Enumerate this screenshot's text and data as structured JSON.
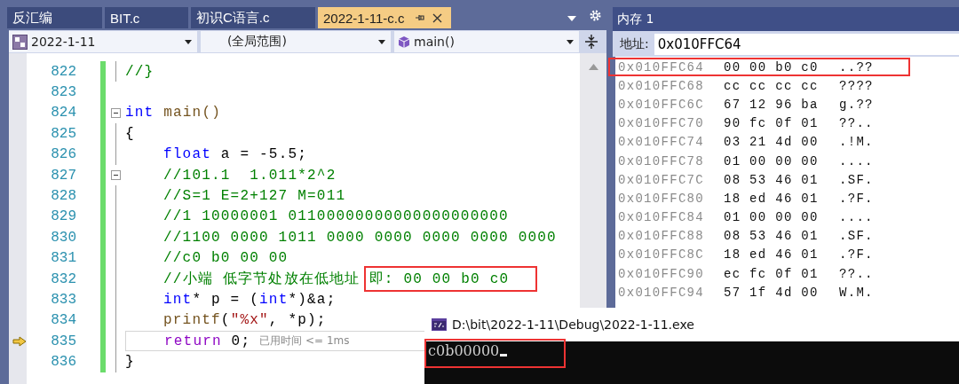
{
  "tabs": [
    {
      "label": "反汇编",
      "selected": false
    },
    {
      "label": "BIT.c",
      "selected": false
    },
    {
      "label": "初识C语言.c",
      "selected": false
    },
    {
      "label": "2022-1-11-c.c",
      "selected": true
    }
  ],
  "navigation": {
    "project": "2022-1-11",
    "scope": "(全局范围)",
    "function": "main()"
  },
  "code_lines": [
    {
      "number": "822",
      "tokens": [
        {
          "kind": "comment",
          "text": "//}"
        }
      ]
    },
    {
      "number": "823"
    },
    {
      "number": "824",
      "collapsible": true,
      "tokens": [
        {
          "kind": "keyword",
          "text": "int"
        },
        {
          "kind": "function",
          "text": " main()"
        }
      ]
    },
    {
      "number": "825",
      "tokens": [
        {
          "kind": "plain",
          "text": "{"
        }
      ],
      "children": [
        {
          "number": "826",
          "tokens": [
            {
              "kind": "keyword",
              "text": "float"
            },
            {
              "kind": "plain",
              "text": " a = -5.5;"
            }
          ]
        },
        {
          "number": "827",
          "collapsible": true,
          "tokens": [
            {
              "kind": "comment",
              "text": "//101.1  1.011*2^2"
            }
          ]
        },
        {
          "number": "828",
          "tokens": [
            {
              "kind": "comment",
              "text": "//S=1 E=2+127 M=011"
            }
          ]
        },
        {
          "number": "829",
          "tokens": [
            {
              "kind": "comment",
              "text": "//1 10000001 01100000000000000000000"
            }
          ]
        },
        {
          "number": "830",
          "tokens": [
            {
              "kind": "comment",
              "text": "//1100 0000 1011 0000 0000 0000 0000 0000"
            }
          ]
        },
        {
          "number": "831",
          "tokens": [
            {
              "kind": "comment",
              "text": "//c0 b0 00 00"
            }
          ]
        },
        {
          "number": "832",
          "tokens": [
            {
              "kind": "comment",
              "text": "//小端 低字节处放在低地址"
            },
            {
              "kind": "comment",
              "text": "即: 00 00 b0 c0",
              "boxed": true
            }
          ]
        },
        {
          "number": "833",
          "tokens": [
            {
              "kind": "keyword",
              "text": "int"
            },
            {
              "kind": "plain",
              "text": "* p = ("
            },
            {
              "kind": "keyword",
              "text": "int"
            },
            {
              "kind": "plain",
              "text": "*)&a;"
            }
          ]
        },
        {
          "number": "834",
          "tokens": [
            {
              "kind": "function",
              "text": "printf"
            },
            {
              "kind": "plain",
              "text": "("
            },
            {
              "kind": "string",
              "text": "\"%x\""
            },
            {
              "kind": "plain",
              "text": ", *p);"
            }
          ]
        },
        {
          "number": "835",
          "current": true,
          "tokens": [
            {
              "kind": "control",
              "text": "return"
            },
            {
              "kind": "plain",
              "text": " 0;"
            },
            {
              "kind": "hint",
              "text": "已用时间 <= 1ms"
            }
          ]
        }
      ]
    },
    {
      "number": "836",
      "tokens": [
        {
          "kind": "plain",
          "text": "}"
        }
      ]
    }
  ],
  "memory": {
    "title": "内存 1",
    "address_label": "地址:",
    "address": "0x010FFC64",
    "rows": [
      {
        "address": "0x010FFC64",
        "bytes": "00 00 b0 c0",
        "chars": "..??",
        "boxed": true
      },
      {
        "address": "0x010FFC68",
        "bytes": "cc cc cc cc",
        "chars": "????",
        "boxed": false
      },
      {
        "address": "0x010FFC6C",
        "bytes": "67 12 96 ba",
        "chars": "g.??",
        "boxed": false
      },
      {
        "address": "0x010FFC70",
        "bytes": "90 fc 0f 01",
        "chars": "??..",
        "boxed": false
      },
      {
        "address": "0x010FFC74",
        "bytes": "03 21 4d 00",
        "chars": ".!M.",
        "boxed": false
      },
      {
        "address": "0x010FFC78",
        "bytes": "01 00 00 00",
        "chars": "....",
        "boxed": false
      },
      {
        "address": "0x010FFC7C",
        "bytes": "08 53 46 01",
        "chars": ".SF.",
        "boxed": false
      },
      {
        "address": "0x010FFC80",
        "bytes": "18 ed 46 01",
        "chars": ".?F.",
        "boxed": false
      },
      {
        "address": "0x010FFC84",
        "bytes": "01 00 00 00",
        "chars": "....",
        "boxed": false
      },
      {
        "address": "0x010FFC88",
        "bytes": "08 53 46 01",
        "chars": ".SF.",
        "boxed": false
      },
      {
        "address": "0x010FFC8C",
        "bytes": "18 ed 46 01",
        "chars": ".?F.",
        "boxed": false
      },
      {
        "address": "0x010FFC90",
        "bytes": "ec fc 0f 01",
        "chars": "??..",
        "boxed": false
      },
      {
        "address": "0x010FFC94",
        "bytes": "57 1f 4d 00",
        "chars": "W.M.",
        "boxed": false
      }
    ]
  },
  "console": {
    "title": "D:\\bit\\2022-1-11\\Debug\\2022-1-11.exe",
    "output": "c0b00000",
    "boxed": true
  }
}
